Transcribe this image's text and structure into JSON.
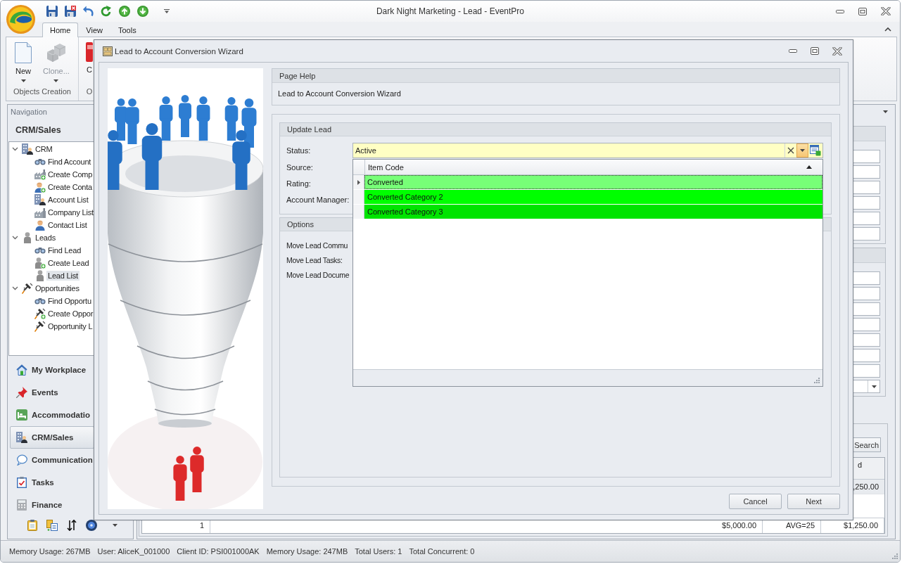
{
  "window": {
    "title": "Dark Night Marketing - Lead - EventPro"
  },
  "ribbon": {
    "tabs": [
      {
        "label": "Home",
        "selected": true
      },
      {
        "label": "View",
        "selected": false
      },
      {
        "label": "Tools",
        "selected": false
      }
    ],
    "groups": [
      {
        "label": "Objects Creation",
        "buttons": [
          {
            "label": "New",
            "disabled": false,
            "dropdown": true
          },
          {
            "label": "Clone...",
            "disabled": true,
            "dropdown": true
          }
        ]
      },
      {
        "label": "O",
        "buttons": [
          {
            "label": "C",
            "disabled": false
          }
        ]
      }
    ]
  },
  "navigation": {
    "header": "Navigation",
    "title": "CRM/Sales",
    "tree": [
      {
        "label": "CRM",
        "expanded": true,
        "selected": false,
        "children": [
          {
            "label": "Find Account",
            "selected": false
          },
          {
            "label": "Create Comp",
            "selected": false
          },
          {
            "label": "Create Conta",
            "selected": false
          },
          {
            "label": "Account List",
            "selected": false
          },
          {
            "label": "Company List",
            "selected": false
          },
          {
            "label": "Contact List",
            "selected": false
          }
        ]
      },
      {
        "label": "Leads",
        "expanded": true,
        "selected": false,
        "children": [
          {
            "label": "Find Lead",
            "selected": false
          },
          {
            "label": "Create Lead",
            "selected": false
          },
          {
            "label": "Lead List",
            "selected": true
          }
        ]
      },
      {
        "label": "Opportunities",
        "expanded": true,
        "selected": false,
        "children": [
          {
            "label": "Find Opportu",
            "selected": false
          },
          {
            "label": "Create Oppor",
            "selected": false
          },
          {
            "label": "Opportunity L",
            "selected": false
          }
        ]
      }
    ],
    "modules": [
      {
        "label": "My Workplace",
        "selected": false
      },
      {
        "label": "Events",
        "selected": false
      },
      {
        "label": "Accommodatio",
        "selected": false
      },
      {
        "label": "CRM/Sales",
        "selected": true
      },
      {
        "label": "Communication",
        "selected": false
      },
      {
        "label": "Tasks",
        "selected": false
      },
      {
        "label": "Finance",
        "selected": false
      }
    ]
  },
  "background_grid": {
    "search_button": "Search",
    "columns": [
      "d"
    ],
    "rows": [
      {
        "cells": [
          ",250.00"
        ],
        "selected": true
      }
    ],
    "footer": [
      "1",
      "$5,000.00",
      "AVG=25",
      "$1,250.00"
    ]
  },
  "dialog": {
    "title": "Lead to Account Conversion Wizard",
    "page_help": {
      "header": "Page Help",
      "text": "Lead to Account Conversion Wizard"
    },
    "update_lead": {
      "header": "Update Lead",
      "fields": [
        {
          "label": "Status:",
          "value": "Active"
        },
        {
          "label": "Source:"
        },
        {
          "label": "Rating:"
        },
        {
          "label": "Account Manager:"
        }
      ]
    },
    "status_dropdown": {
      "column": "Item Code",
      "sorted_ascending": true,
      "rows": [
        {
          "label": "Converted",
          "color": "#77ff77",
          "selected": true
        },
        {
          "label": "Converted Category 2",
          "color": "#00ff00",
          "selected": false
        },
        {
          "label": "Converted Category 3",
          "color": "#00e400",
          "selected": false
        }
      ]
    },
    "options": {
      "header": "Options",
      "fields": [
        "Move Lead Commu",
        "Move Lead Tasks:",
        "Move Lead Docume"
      ]
    },
    "buttons": [
      "Cancel",
      "Next"
    ]
  },
  "status_bar": [
    "Memory Usage: 267MB",
    "User: AliceK_001000",
    "Client ID: PSI001000AK",
    "Memory Usage: 247MB",
    "Total Users: 1",
    "Total Concurrent: 0"
  ]
}
